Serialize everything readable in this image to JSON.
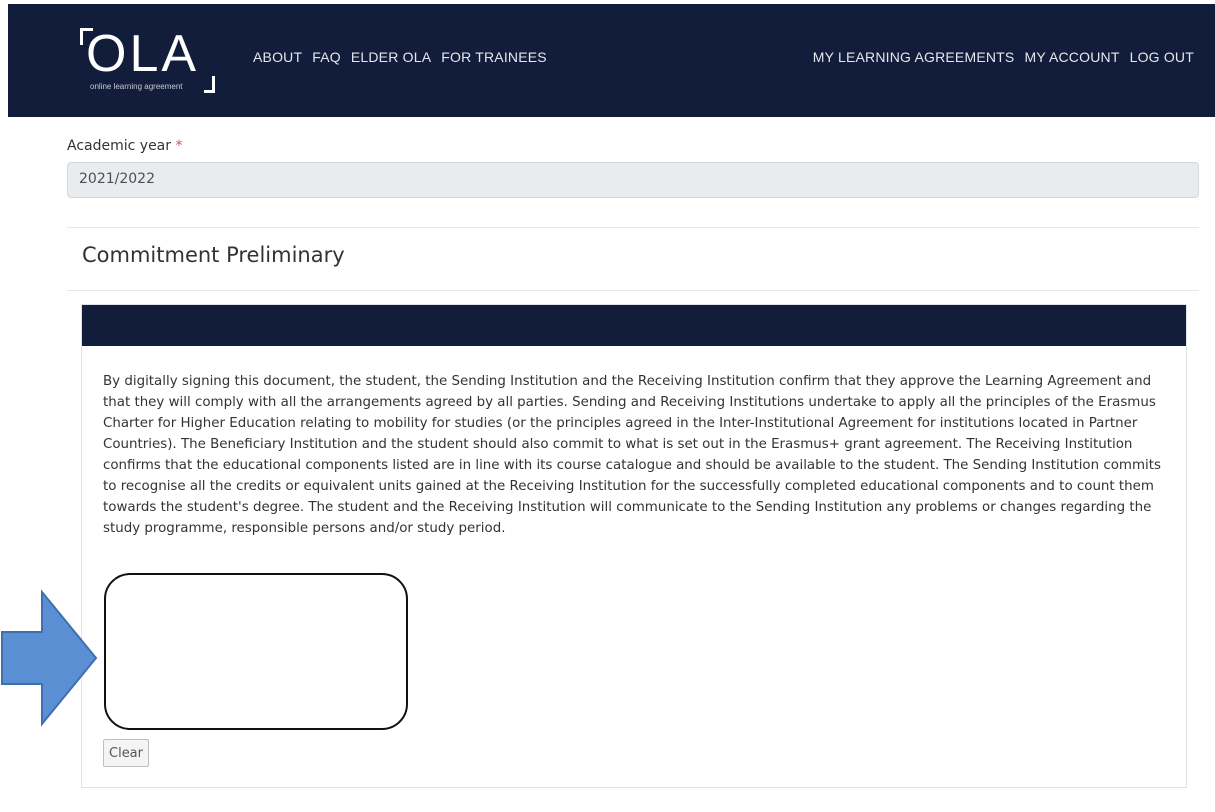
{
  "header": {
    "logo_text": "OLA",
    "logo_tagline": "online learning agreement",
    "nav_left": [
      "ABOUT",
      "FAQ",
      "ELDER OLA",
      "FOR TRAINEES"
    ],
    "nav_right": [
      "MY LEARNING AGREEMENTS",
      "MY ACCOUNT",
      "LOG OUT"
    ]
  },
  "form": {
    "academic_year_label": "Academic year",
    "required_marker": "*",
    "academic_year_value": "2021/2022"
  },
  "section": {
    "title": "Commitment Preliminary",
    "commitment_text": "By digitally signing this document, the student, the Sending Institution and the Receiving Institution confirm that they approve the Learning Agreement and that they will comply with all the arrangements agreed by all parties. Sending and Receiving Institutions undertake to apply all the principles of the Erasmus Charter for Higher Education relating to mobility for studies (or the principles agreed in the Inter-Institutional Agreement for institutions located in Partner Countries). The Beneficiary Institution and the student should also commit to what is set out in the Erasmus+ grant agreement. The Receiving Institution confirms that the educational components listed are in line with its course catalogue and should be available to the student. The Sending Institution commits to recognise all the credits or equivalent units gained at the Receiving Institution for the successfully completed educational components and to count them towards the student's degree. The student and the Receiving Institution will communicate to the Sending Institution any problems or changes regarding the study programme, responsible persons and/or study period.",
    "clear_button": "Clear"
  },
  "colors": {
    "navy": "#111d3a",
    "arrow_fill": "#5b8fd4",
    "required": "#d9534f"
  }
}
